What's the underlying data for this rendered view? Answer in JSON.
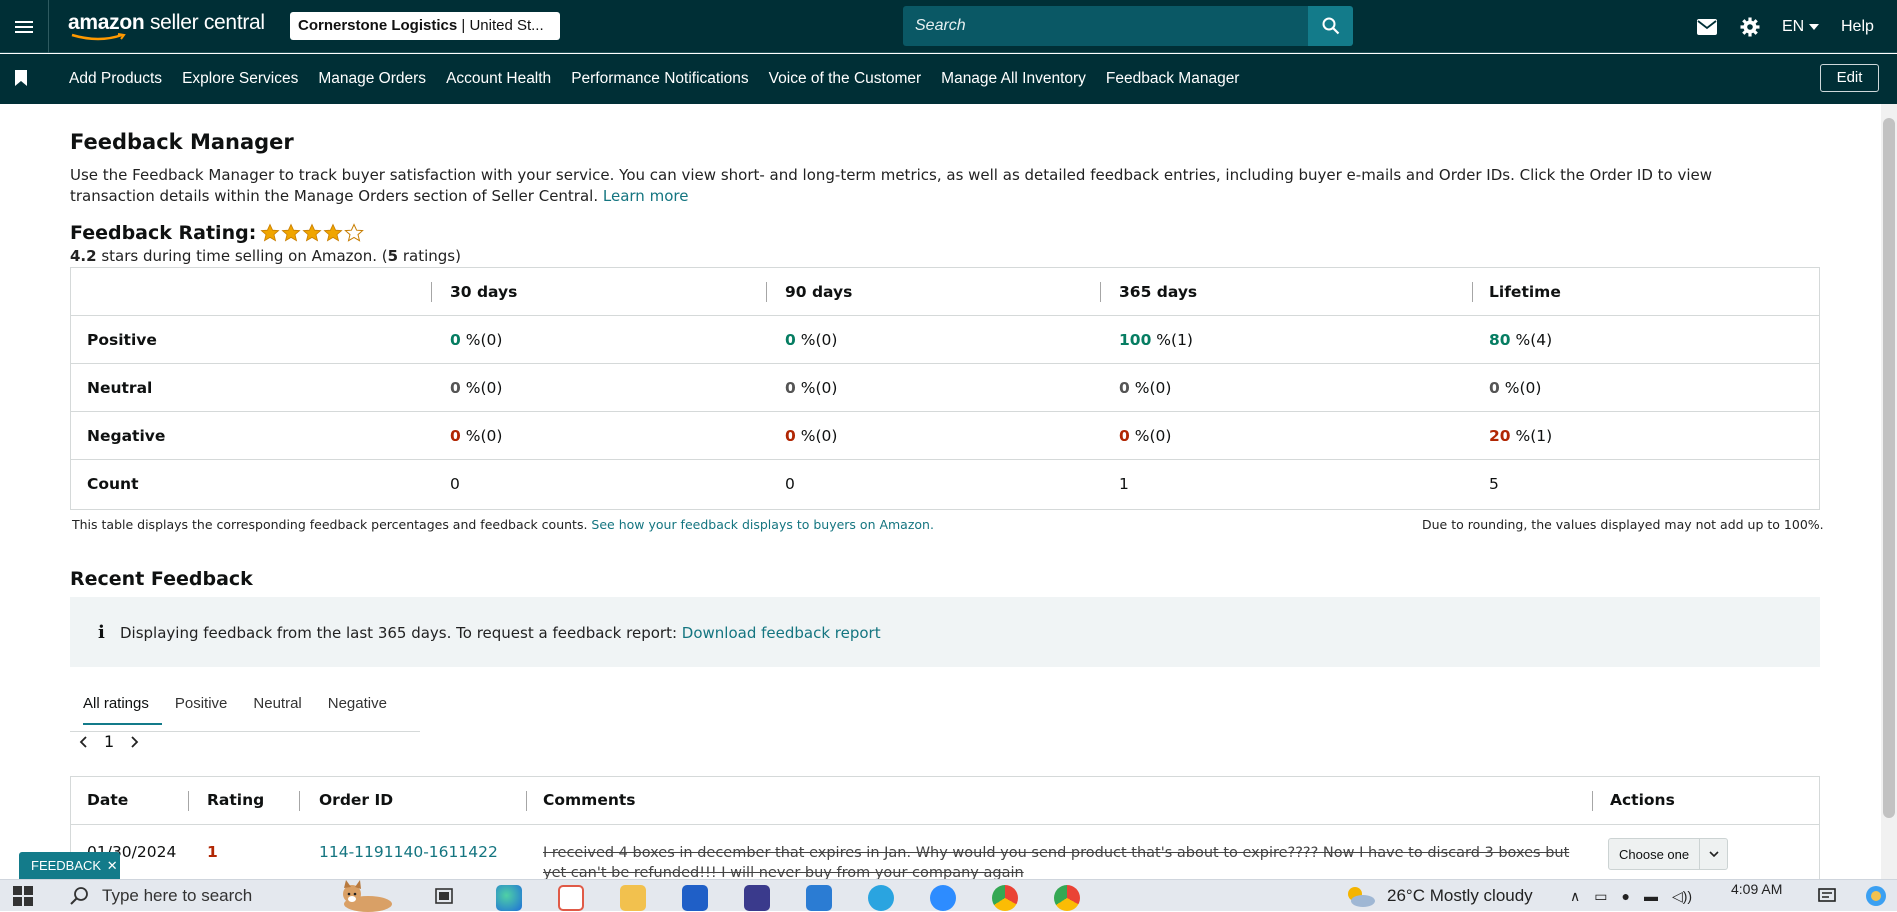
{
  "header": {
    "brand": "amazon",
    "brand_suffix": "seller central",
    "store_name": "Cornerstone Logistics",
    "store_region": "| United St...",
    "search_placeholder": "Search",
    "language": "EN",
    "help": "Help"
  },
  "nav": {
    "items": [
      "Add Products",
      "Explore Services",
      "Manage Orders",
      "Account Health",
      "Performance Notifications",
      "Voice of the Customer",
      "Manage All Inventory",
      "Feedback Manager"
    ],
    "edit": "Edit"
  },
  "page": {
    "title": "Feedback Manager",
    "description": "Use the Feedback Manager to track buyer satisfaction with your service. You can view short- and long-term metrics, as well as detailed feedback entries, including buyer e-mails and Order IDs. Click the Order ID to view transaction details within the Manage Orders section of Seller Central.",
    "learn_more": "Learn more"
  },
  "rating": {
    "label": "Feedback Rating:",
    "stars": 4.2,
    "stars_value": "4.2",
    "summary_mid": "stars during time selling on Amazon. (",
    "count": "5",
    "summary_end": "ratings)"
  },
  "feedback_table": {
    "columns": [
      "30 days",
      "90 days",
      "365 days",
      "Lifetime"
    ],
    "rows": [
      {
        "label": "Positive",
        "cells": [
          {
            "pct": "0",
            "rest": "%(0)"
          },
          {
            "pct": "0",
            "rest": "%(0)"
          },
          {
            "pct": "100",
            "rest": "%(1)"
          },
          {
            "pct": "80",
            "rest": "%(4)"
          }
        ]
      },
      {
        "label": "Neutral",
        "cells": [
          {
            "pct": "0",
            "rest": "%(0)"
          },
          {
            "pct": "0",
            "rest": "%(0)"
          },
          {
            "pct": "0",
            "rest": "%(0)"
          },
          {
            "pct": "0",
            "rest": "%(0)"
          }
        ]
      },
      {
        "label": "Negative",
        "cells": [
          {
            "pct": "0",
            "rest": "%(0)"
          },
          {
            "pct": "0",
            "rest": "%(0)"
          },
          {
            "pct": "0",
            "rest": "%(0)"
          },
          {
            "pct": "20",
            "rest": "%(1)"
          }
        ]
      },
      {
        "label": "Count",
        "cells": [
          "0",
          "0",
          "1",
          "5"
        ]
      }
    ],
    "note_left": "This table displays the corresponding feedback percentages and feedback counts.",
    "note_link": "See how your feedback displays to buyers on Amazon.",
    "note_right": "Due to rounding, the values displayed may not add up to 100%."
  },
  "recent": {
    "title": "Recent Feedback",
    "info": "Displaying feedback from the last 365 days. To request a feedback report:",
    "info_link": "Download feedback report",
    "tabs": [
      "All ratings",
      "Positive",
      "Neutral",
      "Negative"
    ],
    "page": "1",
    "columns": [
      "Date",
      "Rating",
      "Order ID",
      "Comments",
      "Actions"
    ],
    "row": {
      "date": "01/30/2024",
      "rating": "1",
      "order_id": "114-1191140-1611422",
      "comment": "I received 4 boxes in december that expires in Jan. Why would you send product that's about to expire???? Now I have to discard 3 boxes but yet can't be refunded!!! I will never buy from your company again",
      "action": "Choose one"
    }
  },
  "feedback_tab": "FEEDBACK",
  "taskbar": {
    "search_placeholder": "Type here to search",
    "weather": "26°C  Mostly cloudy",
    "time": "4:09 AM"
  },
  "colors": {
    "nav_bg": "#002f36",
    "accent": "#137b8a",
    "positive": "#067d62",
    "negative": "#b12704",
    "star": "#f0a500"
  }
}
